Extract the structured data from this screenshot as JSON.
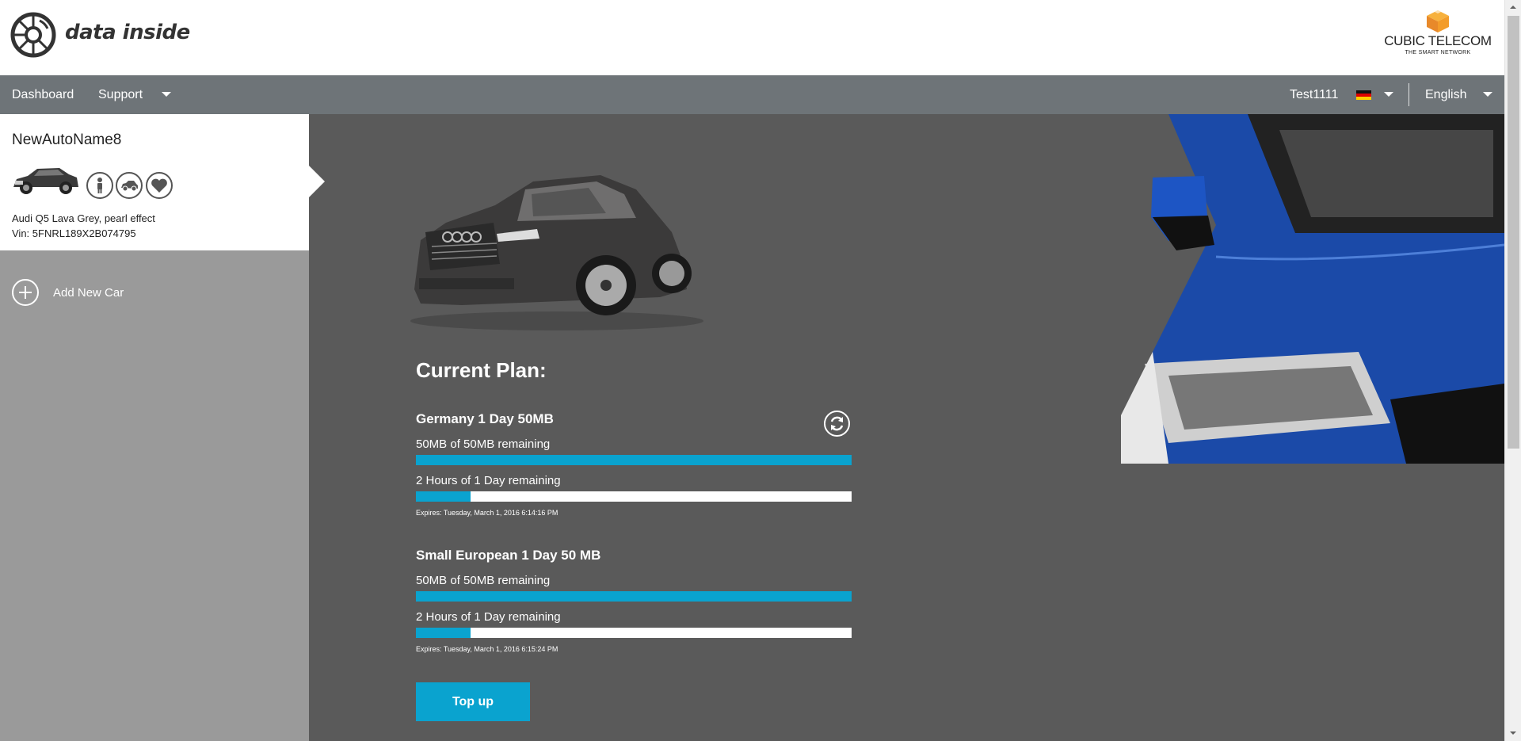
{
  "header": {
    "logo_text": "data inside",
    "brand_name": "CUBIC TELECOM",
    "brand_tagline": "THE SMART NETWORK"
  },
  "nav": {
    "dashboard": "Dashboard",
    "support": "Support",
    "user": "Test1111",
    "language": "English",
    "flag_icon": "germany-flag-icon"
  },
  "sidebar": {
    "car_name": "NewAutoName8",
    "car_model": "Audi Q5 Lava Grey, pearl effect",
    "vin": "Vin: 5FNRL189X2B074795",
    "feature_icons": [
      "person-icon",
      "car-icon",
      "heart-icon"
    ],
    "add_car": "Add New Car"
  },
  "main": {
    "plan_title": "Current Plan:",
    "plans": [
      {
        "name": "Germany 1 Day 50MB",
        "data_label": "50MB of 50MB remaining",
        "data_remaining_fraction": 1.0,
        "time_label": "2 Hours of 1 Day remaining",
        "time_remaining_fraction": 0.125,
        "expires": "Expires: Tuesday, March 1, 2016 6:14:16 PM"
      },
      {
        "name": "Small European 1 Day 50 MB",
        "data_label": "50MB of 50MB remaining",
        "data_remaining_fraction": 1.0,
        "time_label": "2 Hours of 1 Day remaining",
        "time_remaining_fraction": 0.125,
        "expires": "Expires: Tuesday, March 1, 2016 6:15:24 PM"
      }
    ],
    "topup": "Top up"
  },
  "colors": {
    "accent": "#0aa3cf",
    "nav_bg": "#6e7478",
    "main_bg": "#5a5a5a",
    "sidebar_bg": "#9a9a9a"
  }
}
